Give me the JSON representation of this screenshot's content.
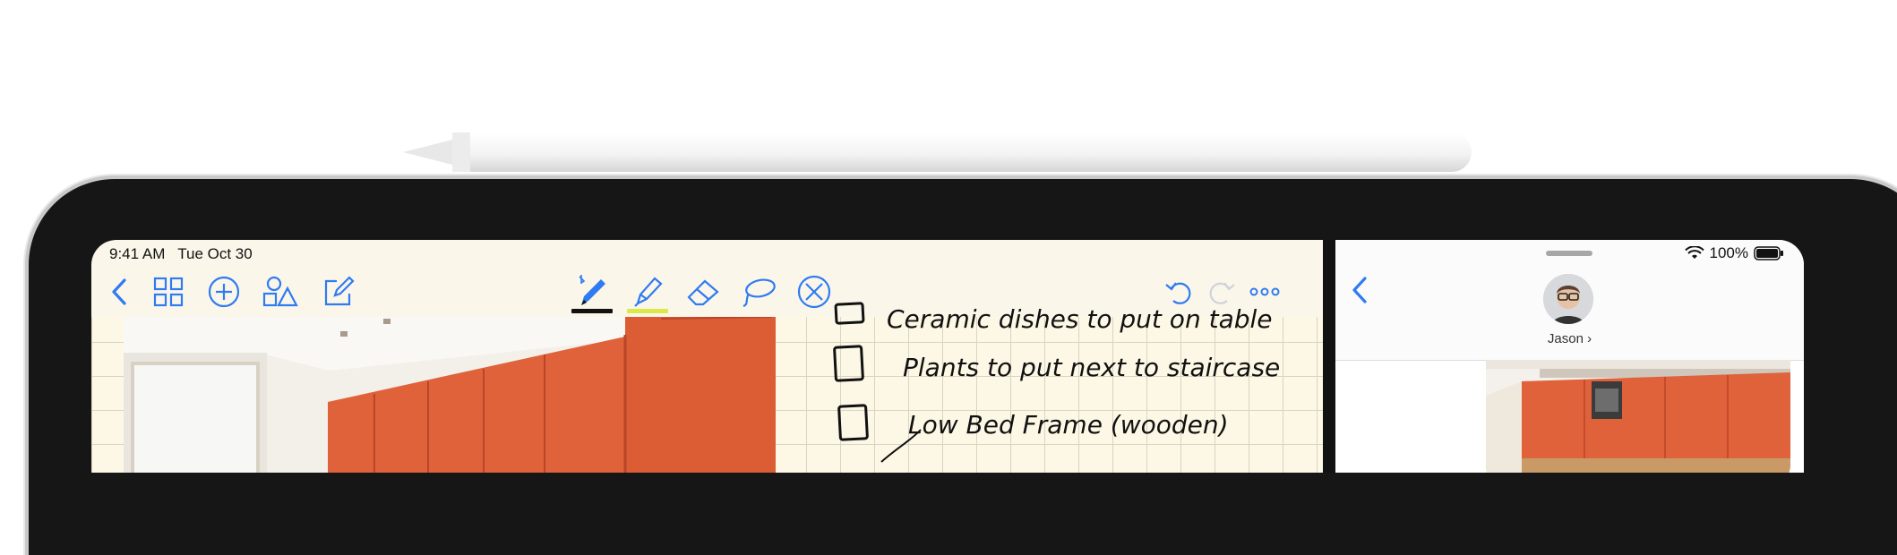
{
  "status_bar_left": {
    "time": "9:41 AM",
    "date": "Tue Oct 30"
  },
  "notes_toolbar": {
    "left_tools": [
      "back-icon",
      "thumbnails-icon",
      "add-icon",
      "shapes-icon",
      "compose-icon"
    ],
    "center_tools": [
      "pen-icon",
      "highlighter-icon",
      "eraser-icon",
      "lasso-icon",
      "close-tool-icon"
    ],
    "right_tools": [
      "undo-icon",
      "redo-icon",
      "more-icon"
    ],
    "pen_color": "#111111",
    "highlighter_color": "#dbe94a",
    "tint": "#2f7bf2"
  },
  "note": {
    "lines": [
      "Ceramic dishes to put on table",
      "Plants to put next to staircase",
      "Low Bed Frame (wooden)"
    ]
  },
  "status_bar_right": {
    "battery": "100%"
  },
  "messages": {
    "contact_name": "Jason",
    "chevron": "›"
  },
  "colors": {
    "accent": "#2f7bf2",
    "cabinet": "#e0623a",
    "bezel": "#161616"
  }
}
